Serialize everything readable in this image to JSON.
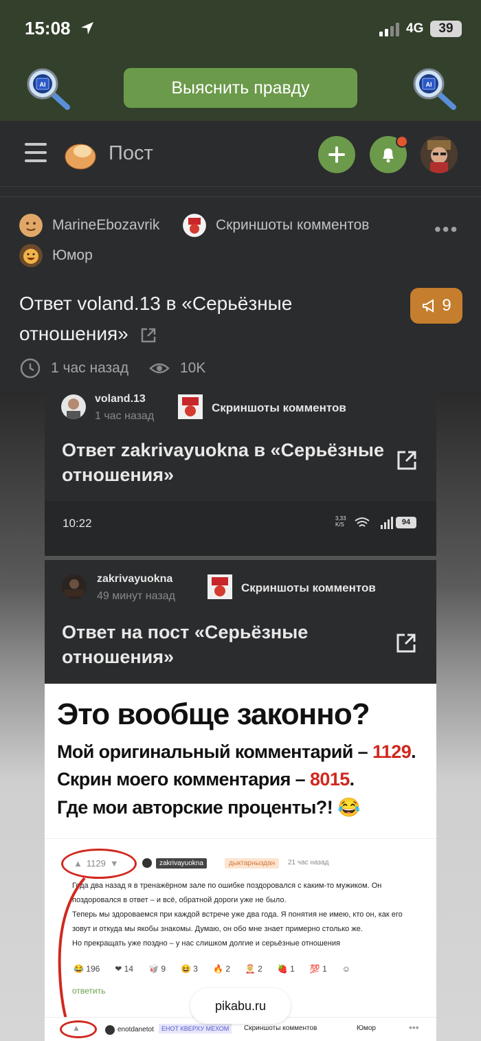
{
  "status_bar": {
    "time": "15:08",
    "network": "4G",
    "battery": "39"
  },
  "top_bar": {
    "truth_button": "Выяснить правду",
    "ai_label": "AI"
  },
  "header": {
    "title": "Пост"
  },
  "post": {
    "author": "MarineEbozavrik",
    "community": "Скриншоты комментов",
    "tag": "Юмор",
    "title": "Ответ voland.13 в «Серьёзные отношения»",
    "comments_count": "9",
    "time": "1 час назад",
    "views": "10K"
  },
  "shot1": {
    "user": "voland.13",
    "time": "1 час назад",
    "community": "Скриншоты комментов",
    "title": "Ответ zakrivayuokna в «Серьёзные отношения»"
  },
  "phone_status": {
    "time": "10:22",
    "speed": "3,33 K/S",
    "battery": "94"
  },
  "shot2": {
    "user": "zakrivayuokna",
    "time": "49 минут назад",
    "community": "Скриншоты комментов",
    "title": "Ответ на пост «Серьёзные отношения»"
  },
  "meme": {
    "headline": "Это вообще законно?",
    "line1_text": "Мой оригинальный комментарий – ",
    "line1_num": "1129",
    "line1_end": ".",
    "line2_text": "Скрин моего комментария – ",
    "line2_num": "8015",
    "line2_end": ".",
    "line3_text": "Где мои авторские проценты?! 😂",
    "comment": {
      "votes": "1129",
      "user": "zakrivayuokna",
      "tag": "дыктарныздан",
      "time": "21 час назад",
      "lines": [
        "Года два назад я в тренажёрном зале по ошибке поздоровался с каким-то мужиком. Он",
        "поздоровался в ответ – и всё, обратной дороги уже не было.",
        "Теперь мы здороваемся при каждой встрече уже два года. Я понятия не имею, кто он, как его",
        "зовут и откуда мы якобы знакомы. Думаю, он обо мне знает примерно столько же.",
        "Но прекращать уже поздно – у нас слишком долгие и серьёзные отношения"
      ],
      "reactions": [
        "😂 196",
        "❤ 14",
        "🥡 9",
        "😆 3",
        "🔥 2",
        "🤶 2",
        "🍓 1",
        "💯 1",
        "☺"
      ],
      "reply": "ответить"
    },
    "bottom": {
      "user": "enotdanetot",
      "tag": "ЕНОТ КВЕРХУ МЕХОМ",
      "community": "Скриншоты комментов",
      "topic": "Юмор"
    }
  },
  "url_pill": "pikabu.ru"
}
